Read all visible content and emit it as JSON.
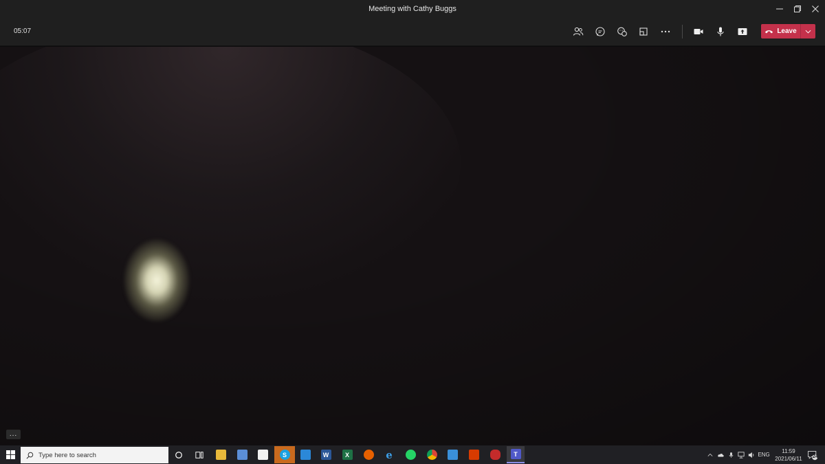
{
  "window": {
    "title": "Meeting with Cathy Buggs"
  },
  "toolbar": {
    "timer": "05:07",
    "leave_label": "Leave"
  },
  "video": {
    "more_options": "..."
  },
  "taskbar": {
    "search_placeholder": "Type here to search",
    "pinned": [
      {
        "name": "cortana",
        "label": ""
      },
      {
        "name": "task-view",
        "label": ""
      },
      {
        "name": "file-explorer",
        "label": ""
      },
      {
        "name": "calculator",
        "label": ""
      },
      {
        "name": "store",
        "label": ""
      },
      {
        "name": "skype",
        "label": "S"
      },
      {
        "name": "mail",
        "label": ""
      },
      {
        "name": "word",
        "label": "W"
      },
      {
        "name": "excel",
        "label": "X"
      },
      {
        "name": "firefox",
        "label": ""
      },
      {
        "name": "edge",
        "label": "e"
      },
      {
        "name": "whatsapp",
        "label": ""
      },
      {
        "name": "chrome",
        "label": ""
      },
      {
        "name": "snip",
        "label": ""
      },
      {
        "name": "office",
        "label": ""
      },
      {
        "name": "app-red",
        "label": ""
      },
      {
        "name": "teams",
        "label": "T"
      }
    ],
    "language": "ENG",
    "time": "11:59",
    "date": "2021/06/11",
    "notification_count": "24"
  },
  "colors": {
    "leave_red": "#c4314b",
    "titlebar_bg": "#1f1f1f",
    "taskbar_bg": "#202024"
  }
}
